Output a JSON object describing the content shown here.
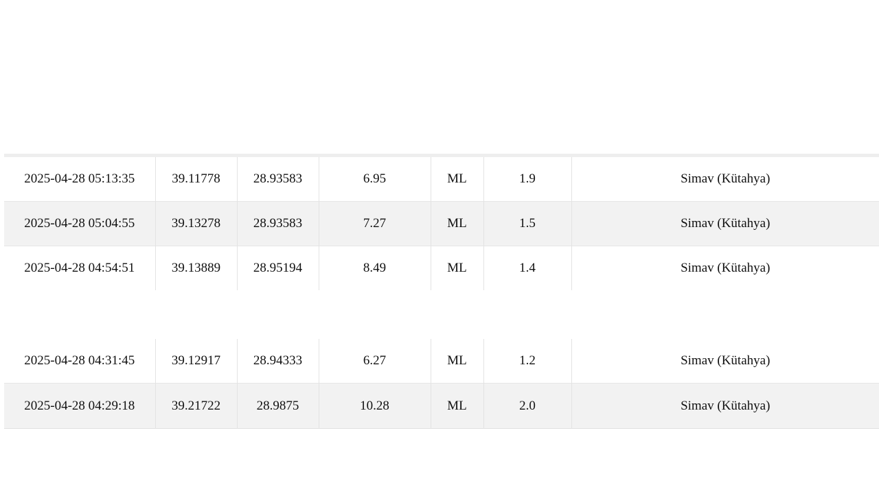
{
  "table": {
    "block_1": [
      {
        "date": "2025-04-28 05:13:35",
        "lat": "39.11778",
        "lon": "28.93583",
        "depth": "6.95",
        "type": "ML",
        "mag": "1.9",
        "location": "Simav (Kütahya)"
      },
      {
        "date": "2025-04-28 05:04:55",
        "lat": "39.13278",
        "lon": "28.93583",
        "depth": "7.27",
        "type": "ML",
        "mag": "1.5",
        "location": "Simav (Kütahya)"
      },
      {
        "date": "2025-04-28 04:54:51",
        "lat": "39.13889",
        "lon": "28.95194",
        "depth": "8.49",
        "type": "ML",
        "mag": "1.4",
        "location": "Simav (Kütahya)"
      }
    ],
    "block_2": [
      {
        "date": "2025-04-28 04:31:45",
        "lat": "39.12917",
        "lon": "28.94333",
        "depth": "6.27",
        "type": "ML",
        "mag": "1.2",
        "location": "Simav (Kütahya)"
      },
      {
        "date": "2025-04-28 04:29:18",
        "lat": "39.21722",
        "lon": "28.9875",
        "depth": "10.28",
        "type": "ML",
        "mag": "2.0",
        "location": "Simav (Kütahya)"
      }
    ]
  },
  "colors": {
    "stripe": "#f2f2f2",
    "border": "#e3e3e3",
    "text": "#111111"
  }
}
